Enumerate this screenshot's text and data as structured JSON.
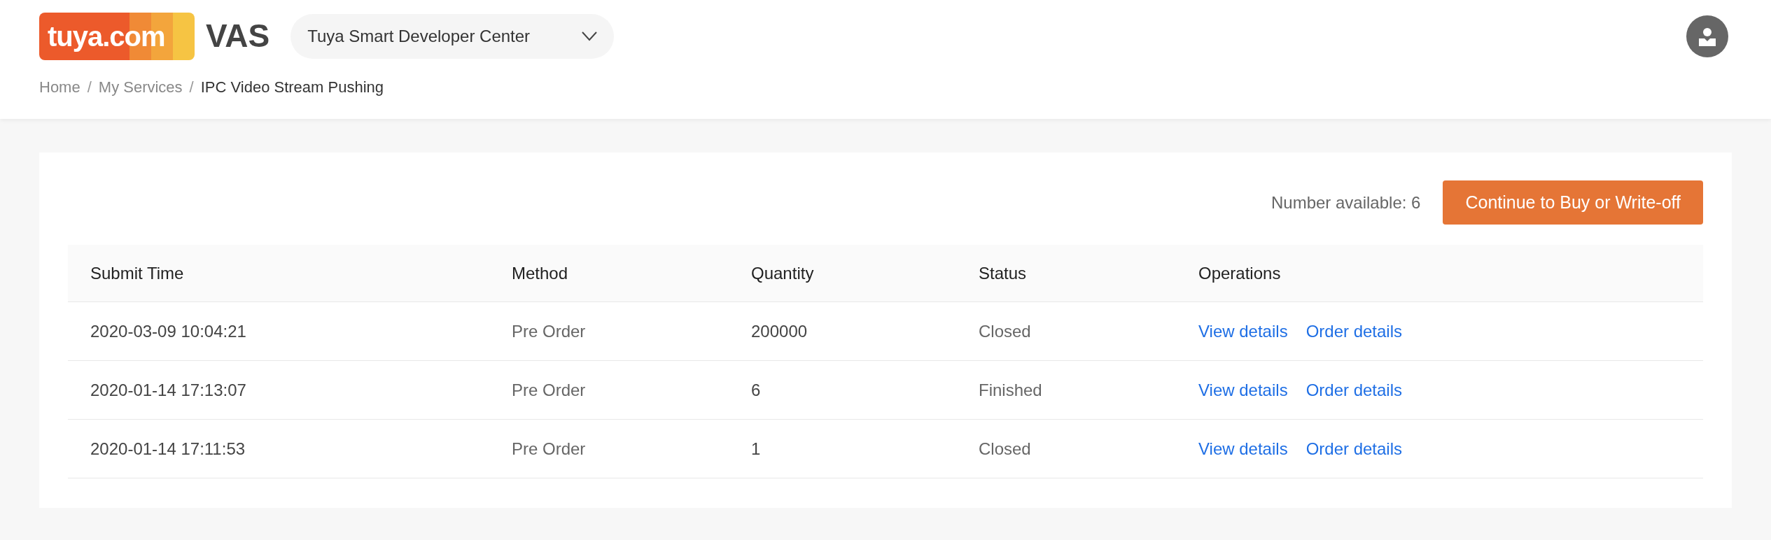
{
  "header": {
    "logo": "tuya.com",
    "product": "VAS",
    "workspace": "Tuya Smart Developer Center"
  },
  "breadcrumb": [
    {
      "label": "Home",
      "current": false
    },
    {
      "label": "My Services",
      "current": false
    },
    {
      "label": "IPC Video Stream Pushing",
      "current": true
    }
  ],
  "breadcrumb_separator": "/",
  "available": "Number available: 6",
  "action_button": "Continue to Buy or Write-off",
  "table": {
    "columns": [
      "Submit Time",
      "Method",
      "Quantity",
      "Status",
      "Operations"
    ],
    "rows": [
      {
        "submit_time": "2020-03-09 10:04:21",
        "method": "Pre Order",
        "quantity": "200000",
        "status": "Closed",
        "operations": [
          "View details",
          "Order details"
        ]
      },
      {
        "submit_time": "2020-01-14 17:13:07",
        "method": "Pre Order",
        "quantity": "6",
        "status": "Finished",
        "operations": [
          "View details",
          "Order details"
        ]
      },
      {
        "submit_time": "2020-01-14 17:11:53",
        "method": "Pre Order",
        "quantity": "1",
        "status": "Closed",
        "operations": [
          "View details",
          "Order details"
        ]
      }
    ]
  }
}
